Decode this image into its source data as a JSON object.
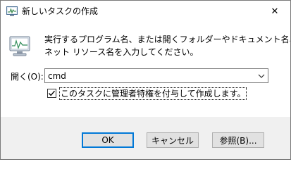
{
  "window": {
    "title": "新しいタスクの作成",
    "close_glyph": "✕"
  },
  "description": {
    "line1": "実行するプログラム名、または開くフォルダーやドキュメント名、インター",
    "line2": "ネット リソース名を入力してください。"
  },
  "open_field": {
    "label": "開く(O):",
    "value": "cmd"
  },
  "admin_option": {
    "label": "このタスクに管理者特権を付与して作成します。",
    "checked": true
  },
  "buttons": {
    "ok": "OK",
    "cancel": "キャンセル",
    "browse": "参照(B)..."
  },
  "colors": {
    "accent": "#0078d7",
    "footer_bg": "#f0f0f0",
    "button_bg": "#e1e1e1"
  }
}
